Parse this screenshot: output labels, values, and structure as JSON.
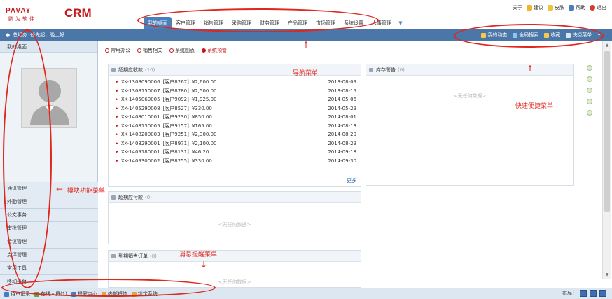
{
  "brand": {
    "logo": "PAVAY",
    "company": "鹏为软件",
    "product": "CRM"
  },
  "nav": {
    "items": [
      "我的桌面",
      "客户管理",
      "销售管理",
      "采购管理",
      "财务管理",
      "产品管理",
      "市场管理",
      "系统设置",
      "人事管理"
    ],
    "active": "我的桌面",
    "more_icon": "chevron-down-icon"
  },
  "toplinks": [
    {
      "label": "关于",
      "icon": ""
    },
    {
      "label": "建议",
      "icon": "mail-icon"
    },
    {
      "label": "皮肤",
      "icon": "skin-icon"
    },
    {
      "label": "帮助",
      "icon": "help-icon"
    },
    {
      "label": "退出",
      "icon": "power-icon"
    }
  ],
  "greeting": {
    "user": "总经办",
    "message": "任先超，晚上好"
  },
  "quick": [
    {
      "label": "我的动态"
    },
    {
      "label": "全局搜索"
    },
    {
      "label": "收藏"
    },
    {
      "label": "快捷菜单"
    }
  ],
  "quick_more": "···",
  "sidebar": {
    "title": "我的桌面",
    "menu": [
      "通讯管理",
      "外勤管理",
      "公文事务",
      "审批管理",
      "会议管理",
      "点评管理",
      "常用工具",
      "移动平台"
    ]
  },
  "tabs": [
    {
      "label": "常用办公",
      "active": false
    },
    {
      "label": "销售相关",
      "active": false
    },
    {
      "label": "系统图表",
      "active": false
    },
    {
      "label": "系统预警",
      "active": true
    }
  ],
  "panels": {
    "receivable": {
      "title": "超期应收款",
      "count": "(10)",
      "rows": [
        {
          "code": "XK-1308090006",
          "customer": "[客户8267]",
          "amount": "¥2,600.00",
          "date": "2013-08-09"
        },
        {
          "code": "XK-1308150007",
          "customer": "[客户8780]",
          "amount": "¥2,500.00",
          "date": "2013-08-15"
        },
        {
          "code": "XK-1405060005",
          "customer": "[客户9092]",
          "amount": "¥1,925.00",
          "date": "2014-05-06"
        },
        {
          "code": "XK-1405290008",
          "customer": "[客户8527]",
          "amount": "¥330.00",
          "date": "2014-05-29"
        },
        {
          "code": "XK-1408010001",
          "customer": "[客户9230]",
          "amount": "¥850.00",
          "date": "2014-08-01"
        },
        {
          "code": "XK-1408130005",
          "customer": "[客户9157]",
          "amount": "¥165.00",
          "date": "2014-08-13"
        },
        {
          "code": "XK-1408200003",
          "customer": "[客户9251]",
          "amount": "¥2,300.00",
          "date": "2014-08-20"
        },
        {
          "code": "XK-1408290001",
          "customer": "[客户8971]",
          "amount": "¥2,100.00",
          "date": "2014-08-29"
        },
        {
          "code": "XK-1409180001",
          "customer": "[客户8131]",
          "amount": "¥46.20",
          "date": "2014-09-18"
        },
        {
          "code": "XK-1409300002",
          "customer": "[客户8255]",
          "amount": "¥330.00",
          "date": "2014-09-30"
        }
      ],
      "more": "更多"
    },
    "stock": {
      "title": "库存警告",
      "count": "(0)",
      "empty": "<无任何数据>"
    },
    "payable": {
      "title": "超期应付款",
      "count": "(0)",
      "empty": "<无任何数据>"
    },
    "orders": {
      "title": "到期销售订单",
      "count": "(0)",
      "empty": "<无任何数据>"
    }
  },
  "statusbar": {
    "items": [
      {
        "label": "待审记录",
        "color": "#3c7fc4"
      },
      {
        "label": "在线人员(1)",
        "color": "#5aa845"
      },
      {
        "label": "提醒中心",
        "color": "#3c7fc4"
      },
      {
        "label": "内部短信",
        "color": "#e2a33a"
      },
      {
        "label": "锁定系统",
        "color": "#e2a33a"
      }
    ],
    "layout_label": "布局："
  },
  "annotations": {
    "nav": "导航菜单",
    "quick": "快速便捷菜单",
    "module": "模块功能菜单",
    "message": "消息提醒菜单"
  },
  "colors": {
    "brand": "#c4161c",
    "nav_active": "#4a7fb8",
    "subbar": "#4a76a8",
    "annotation": "#e1261c"
  }
}
